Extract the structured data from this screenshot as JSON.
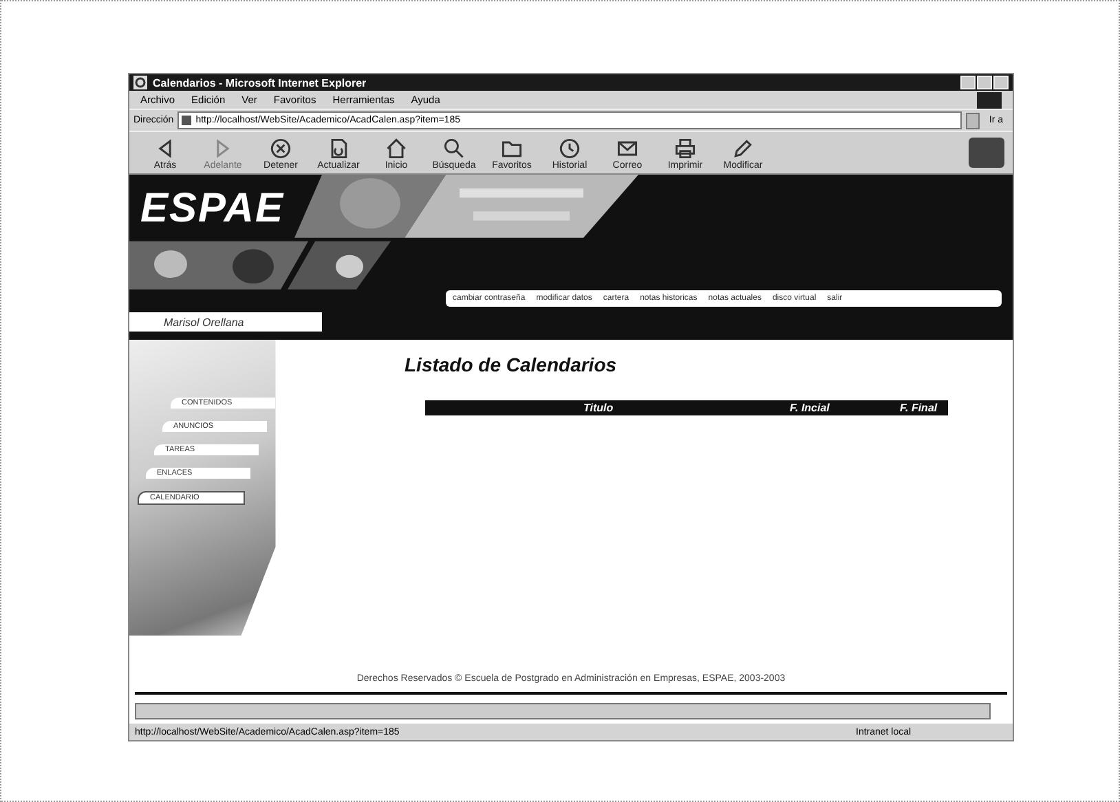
{
  "window": {
    "title": "Calendarios - Microsoft Internet Explorer"
  },
  "menu": [
    "Archivo",
    "Edición",
    "Ver",
    "Favoritos",
    "Herramientas",
    "Ayuda"
  ],
  "address": {
    "label": "Dirección",
    "url": "http://localhost/WebSite/Academico/AcadCalen.asp?item=185",
    "go": "Ir a"
  },
  "toolbar": [
    {
      "label": "Atrás",
      "disabled": false
    },
    {
      "label": "Adelante",
      "disabled": true
    },
    {
      "label": "Detener",
      "disabled": false
    },
    {
      "label": "Actualizar",
      "disabled": false
    },
    {
      "label": "Inicio",
      "disabled": false
    },
    {
      "label": "Búsqueda",
      "disabled": false
    },
    {
      "label": "Favoritos",
      "disabled": false
    },
    {
      "label": "Historial",
      "disabled": false
    },
    {
      "label": "Correo",
      "disabled": false
    },
    {
      "label": "Imprimir",
      "disabled": false
    },
    {
      "label": "Modificar",
      "disabled": false
    }
  ],
  "site": {
    "logo": "ESPAE",
    "user": "Marisol Orellana",
    "top_links": [
      "cambiar contraseña",
      "modificar datos",
      "cartera",
      "notas historicas",
      "notas actuales",
      "disco virtual",
      "salir"
    ],
    "nav": [
      {
        "label": "CONTENIDOS",
        "selected": false
      },
      {
        "label": "ANUNCIOS",
        "selected": false
      },
      {
        "label": "TAREAS",
        "selected": false
      },
      {
        "label": "ENLACES",
        "selected": false
      },
      {
        "label": "CALENDARIO",
        "selected": true
      }
    ],
    "heading": "Listado de Calendarios",
    "table": {
      "columns": [
        "Titulo",
        "F. Incial",
        "F. Final"
      ]
    },
    "footer": "Derechos Reservados © Escuela de Postgrado en Administración en Empresas, ESPAE, 2003-2003"
  },
  "status_bar": {
    "url": "http://localhost/WebSite/Academico/AcadCalen.asp?item=185",
    "zone": "Intranet local"
  }
}
